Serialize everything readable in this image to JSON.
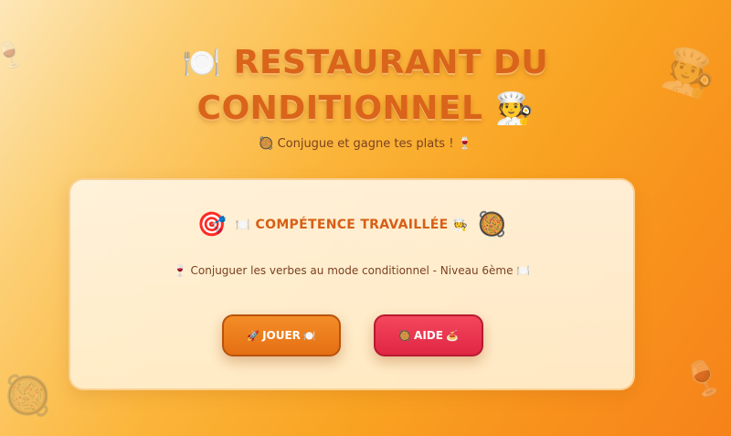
{
  "background_decor": [
    "🍷",
    "🧑‍🍳",
    "🥘",
    "🍷"
  ],
  "header": {
    "title_icon_left": "🍽️",
    "title_line1": "RESTAURANT DU",
    "title_line2": "CONDITIONNEL",
    "title_icon_right": "🧑‍🍳",
    "subtitle_icon_left": "🥘",
    "subtitle": "Conjugue et gagne tes plats !",
    "subtitle_icon_right": "🍷"
  },
  "card": {
    "icon_left": "🎯",
    "title_icon_left": "🍽️",
    "title": "COMPÉTENCE TRAVAILLÉE",
    "title_icon_right": "🧑‍🍳",
    "icon_right": "🥘",
    "description_icon_left": "🍷",
    "description": "Conjuguer les verbes au mode conditionnel - Niveau 6ème",
    "description_icon_right": "🍽️"
  },
  "buttons": {
    "play": {
      "icon_left": "🚀",
      "label": "JOUER",
      "icon_right": "🍽️"
    },
    "help": {
      "icon_left": "🥘",
      "label": "AIDE",
      "icon_right": "🍝"
    }
  },
  "colors": {
    "background_start": "#fde7b8",
    "background_end": "#f6821a",
    "title": "#d9641a",
    "play_button": "#e56f14",
    "help_button": "#e02644"
  }
}
